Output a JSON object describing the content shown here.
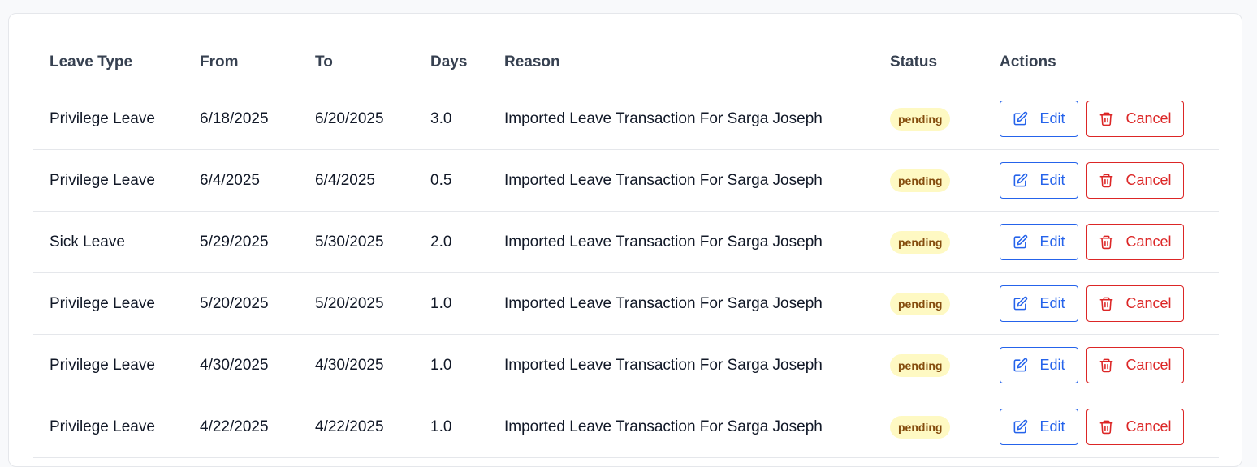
{
  "table": {
    "headers": [
      "Leave Type",
      "From",
      "To",
      "Days",
      "Reason",
      "Status",
      "Actions"
    ],
    "rows": [
      {
        "type": "Privilege Leave",
        "from": "6/18/2025",
        "to": "6/20/2025",
        "days": "3.0",
        "reason": "Imported Leave Transaction For Sarga Joseph",
        "status": "pending"
      },
      {
        "type": "Privilege Leave",
        "from": "6/4/2025",
        "to": "6/4/2025",
        "days": "0.5",
        "reason": "Imported Leave Transaction For Sarga Joseph",
        "status": "pending"
      },
      {
        "type": "Sick Leave",
        "from": "5/29/2025",
        "to": "5/30/2025",
        "days": "2.0",
        "reason": "Imported Leave Transaction For Sarga Joseph",
        "status": "pending"
      },
      {
        "type": "Privilege Leave",
        "from": "5/20/2025",
        "to": "5/20/2025",
        "days": "1.0",
        "reason": "Imported Leave Transaction For Sarga Joseph",
        "status": "pending"
      },
      {
        "type": "Privilege Leave",
        "from": "4/30/2025",
        "to": "4/30/2025",
        "days": "1.0",
        "reason": "Imported Leave Transaction For Sarga Joseph",
        "status": "pending"
      },
      {
        "type": "Privilege Leave",
        "from": "4/22/2025",
        "to": "4/22/2025",
        "days": "1.0",
        "reason": "Imported Leave Transaction For Sarga Joseph",
        "status": "pending"
      }
    ]
  },
  "actions": {
    "edit_label": "Edit",
    "cancel_label": "Cancel",
    "edit_icon": "pencil-square-icon",
    "cancel_icon": "trash-icon"
  },
  "colors": {
    "edit": "#2563eb",
    "cancel": "#dc2626",
    "pending_bg": "#fef9c3",
    "pending_text": "#854d0e"
  }
}
